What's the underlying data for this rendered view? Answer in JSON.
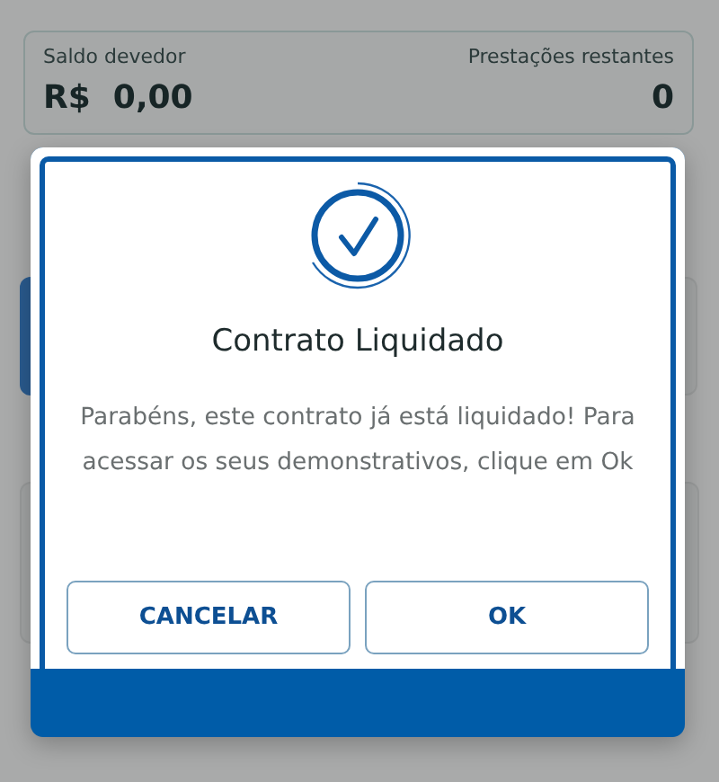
{
  "summary": {
    "balance_label": "Saldo devedor",
    "balance_value": "R$  0,00",
    "installments_label": "Prestações restantes",
    "installments_value": "0"
  },
  "dialog": {
    "title": "Contrato Liquidado",
    "message": "Parabéns, este contrato já está liquidado! Para acessar os seus demonstrativos, clique em Ok",
    "buttons": [
      {
        "label": "CANCELAR"
      },
      {
        "label": "OK"
      }
    ]
  }
}
